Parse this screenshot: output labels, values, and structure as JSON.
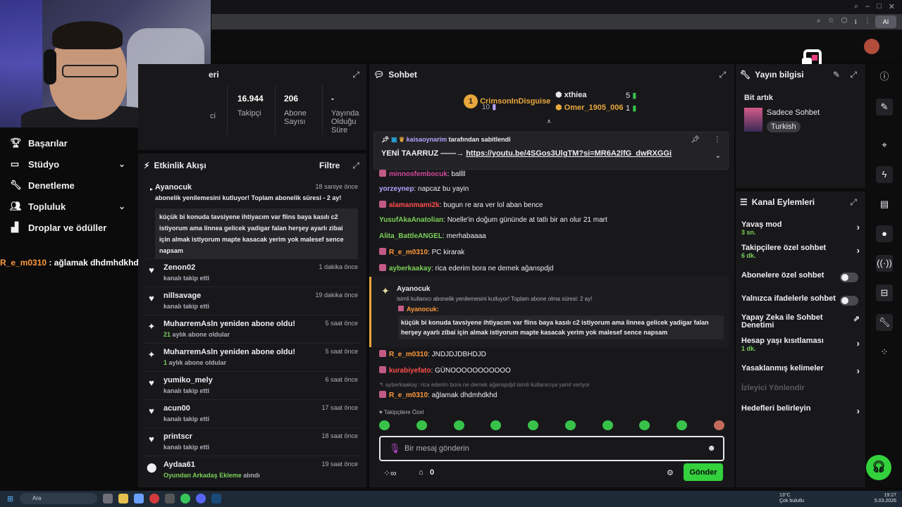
{
  "nav": {
    "items": [
      {
        "label": "Başarılar",
        "icon": "trophy-icon"
      },
      {
        "label": "Stüdyo",
        "icon": "video-icon"
      },
      {
        "label": "Denetleme",
        "icon": "wrench-icon"
      },
      {
        "label": "Topluluk",
        "icon": "people-icon"
      },
      {
        "label": "Droplar ve ödüller",
        "icon": "gift-icon"
      }
    ]
  },
  "overlay_chat": {
    "user": "R_e_m0310",
    "text": " : ağlamak dhdmhdkhd"
  },
  "stats": {
    "title_partial": "eri",
    "followers_value": "16.944",
    "followers_label": "Takipçi",
    "subs_value": "206",
    "subs_label": "Abone Sayısı",
    "uptime_value": "-",
    "uptime_label": "Yayında Olduğu Süre",
    "partial_label": "ci"
  },
  "activity": {
    "title": "Etkinlik Akışı",
    "filter": "Filtre",
    "items": [
      {
        "name": "Ayanocuk",
        "time": "18 saniye önce",
        "sub": "abonelik yenilemesini kutluyor! Toplam abonelik süresi - 2 ay!",
        "quote": "küçük bi konuda tavsiyene ihtiyacım var flins baya kasılı c2 istiyorum ama linnea gelicek yadigar falan herşey ayarlı zibai için almak istiyorum mapte kasacak yerim yok malesef sence napsam"
      },
      {
        "name": "Zenon02",
        "time": "1 dakika önce",
        "sub": "kanalı takip etti"
      },
      {
        "name": "nillsavage",
        "time": "19 dakika önce",
        "sub": "kanalı takip etti"
      },
      {
        "name": "MuharremAsln yeniden abone oldu!",
        "time": "5 saat önce",
        "sub_num": "21",
        "sub": " aylık abone oldular"
      },
      {
        "name": "MuharremAsln yeniden abone oldu!",
        "time": "5 saat önce",
        "sub_num": "1",
        "sub": " aylık abone oldular"
      },
      {
        "name": "yumiko_mely",
        "time": "6 saat önce",
        "sub": "kanalı takip etti"
      },
      {
        "name": "acun00",
        "time": "17 saat önce",
        "sub": "kanalı takip etti"
      },
      {
        "name": "printscr",
        "time": "18 saat önce",
        "sub": "kanalı takip etti"
      },
      {
        "name": "Aydaa61",
        "time": "19 saat önce",
        "sub_green": "Oyundan Arkadaş Ekleme",
        "sub": " alındı"
      }
    ]
  },
  "chat": {
    "title": "Sohbet",
    "leaders": [
      {
        "rank": "1",
        "name": "CrimsonInDisguise",
        "count": "10"
      },
      {
        "name": "xthiea",
        "count": "5"
      },
      {
        "name": "Omer_1905_006",
        "count": "1"
      }
    ],
    "pinned": {
      "user": "kaisaoynarim",
      "by_text": " tarafından sabitlendi",
      "text": "YENİ TAARRUZ ——→ ",
      "link": "https://youtu.be/4SGos3UlgTM?si=MR6A2lfG_dwRXGGi"
    },
    "messages": [
      {
        "user": "minnosfembocuk",
        "text": ": ballll",
        "color": "#d04a9a"
      },
      {
        "user": "yorzeynep",
        "text": ": napcaz bu yayin",
        "color": "#b8a2ff"
      },
      {
        "user": "alamanmami2k",
        "text": ": bugun re ara ver lol aban bence",
        "color": "#ff4d4d"
      },
      {
        "user": "YusufAkaAnatolian",
        "text": ": Noelle'in doğum gününde at tatlı bir an olur 21 mart",
        "color": "#7cd15a"
      },
      {
        "user": "Alita_BattleANGEL",
        "text": ": merhabaaaa",
        "color": "#7cd15a"
      },
      {
        "user": "R_e_m0310",
        "text": ": PC kirarak",
        "color": "#ff9a3c"
      },
      {
        "user": "ayberkaakay",
        "text": ": rica ederim bora ne demek ağanspdjd",
        "color": "#7cd15a"
      }
    ],
    "highlight": {
      "name": "Ayanocuk",
      "sub": "isimli kullanıcı abonelik yenilemesini kutluyor! Toplam abone olma süresi: 2 ay!",
      "quote_user": "Ayanocuk:",
      "quote": "küçük bi konuda tavsiyene ihtiyacım var flins baya kasılı c2 istiyorum ama linnea gelicek yadigar falan herşey ayarlı zibai için almak istiyorum mapte kasacak yerim yok malesef sence napsam"
    },
    "messages2": [
      {
        "user": "R_e_m0310",
        "text": ": JNDJDJDBHDJD",
        "color": "#ff9a3c"
      },
      {
        "user": "kurabiyefato",
        "text": ": GÜNOOOOOOOOOOO",
        "color": "#ff4d4d"
      }
    ],
    "reply_hint": "ayberkaakay: rica ederim bora ne demek ağanspdjd isimli kullanıcıya yanıt veriyor",
    "last_msg": {
      "user": "R_e_m0310",
      "text": ": ağlamak dhdmhdkhd",
      "color": "#ff9a3c"
    },
    "followers_only": "Takipçilere Özel",
    "input_placeholder": "Bir mesaj gönderin",
    "points": "0",
    "send": "Gönder"
  },
  "stream_info": {
    "title": "Yayın bilgisi",
    "stream_title": "Bit artık",
    "category": "Sadece Sohbet",
    "tag": "Turkish"
  },
  "channel_actions": {
    "title": "Kanal Eylemleri",
    "rows": [
      {
        "label": "Yavaş mod",
        "value": "3 sn.",
        "kind": "chevron"
      },
      {
        "label": "Takipçilere özel sohbet",
        "value": "6 dk.",
        "kind": "chevron"
      },
      {
        "label": "Abonelere özel sohbet",
        "kind": "toggle"
      },
      {
        "label": "Yalnızca ifadelerle sohbet",
        "kind": "toggle"
      },
      {
        "label": "Yapay Zeka ile Sohbet Denetimi",
        "kind": "external"
      },
      {
        "label": "Hesap yaşı kısıtlaması",
        "value": "1 dk.",
        "kind": "chevron"
      },
      {
        "label": "Yasaklanmış kelimeler",
        "kind": "chevron"
      },
      {
        "label": "İzleyici Yönlendir",
        "kind": "disabled"
      },
      {
        "label": "Hedefleri belirleyin",
        "kind": "chevron"
      }
    ]
  },
  "taskbar": {
    "search": "Ara",
    "weather_temp": "13°C",
    "weather_desc": "Çok bulutlu",
    "time": "19:27",
    "date": "5.03.2026"
  },
  "colors": {
    "accent": "#33d13c",
    "panel": "#18181b",
    "bg": "#0b0b0c"
  }
}
